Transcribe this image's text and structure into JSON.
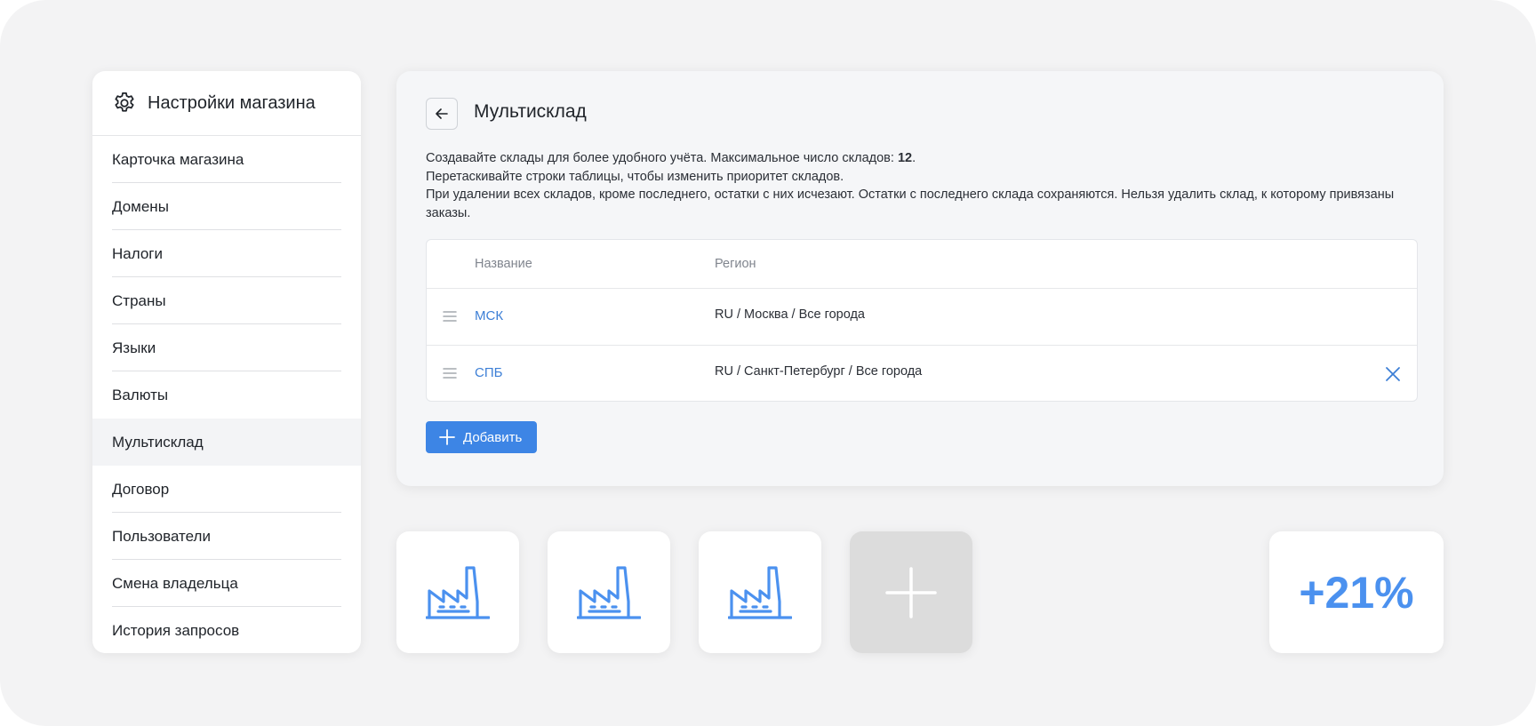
{
  "sidebar": {
    "title": "Настройки магазина",
    "items": [
      {
        "label": "Карточка магазина"
      },
      {
        "label": "Домены"
      },
      {
        "label": "Налоги"
      },
      {
        "label": "Страны"
      },
      {
        "label": "Языки"
      },
      {
        "label": "Валюты"
      },
      {
        "label": "Мультисклад",
        "active": true
      },
      {
        "label": "Договор"
      },
      {
        "label": "Пользователи"
      },
      {
        "label": "Смена владельца"
      },
      {
        "label": "История запросов"
      }
    ]
  },
  "main": {
    "title": "Мультисклад",
    "description": {
      "line1_prefix": "Создавайте склады для более удобного учёта. Максимальное число складов: ",
      "max_warehouses": "12",
      "line1_suffix": ".",
      "line2": "Перетаскивайте строки таблицы, чтобы изменить приоритет складов.",
      "line3": "При удалении всех складов, кроме последнего, остатки с них исчезают. Остатки с последнего склада сохраняются. Нельзя удалить склад, к которому привязаны заказы."
    },
    "table": {
      "columns": [
        "Название",
        "Регион"
      ],
      "rows": [
        {
          "name": "МСК",
          "region": "RU / Москва / Все города",
          "deletable": false
        },
        {
          "name": "СПБ",
          "region": "RU / Санкт-Петербург / Все города",
          "deletable": true
        }
      ]
    },
    "add_button_label": "Добавить"
  },
  "tiles": {
    "warehouse_icons": [
      "factory-icon",
      "factory-icon",
      "factory-icon"
    ],
    "add_icon": "plus-icon",
    "stat_value": "+21%"
  },
  "colors": {
    "accent": "#3d85e5",
    "link": "#3d7fd6",
    "stat": "#4b91ef",
    "background": "#f3f3f4"
  }
}
